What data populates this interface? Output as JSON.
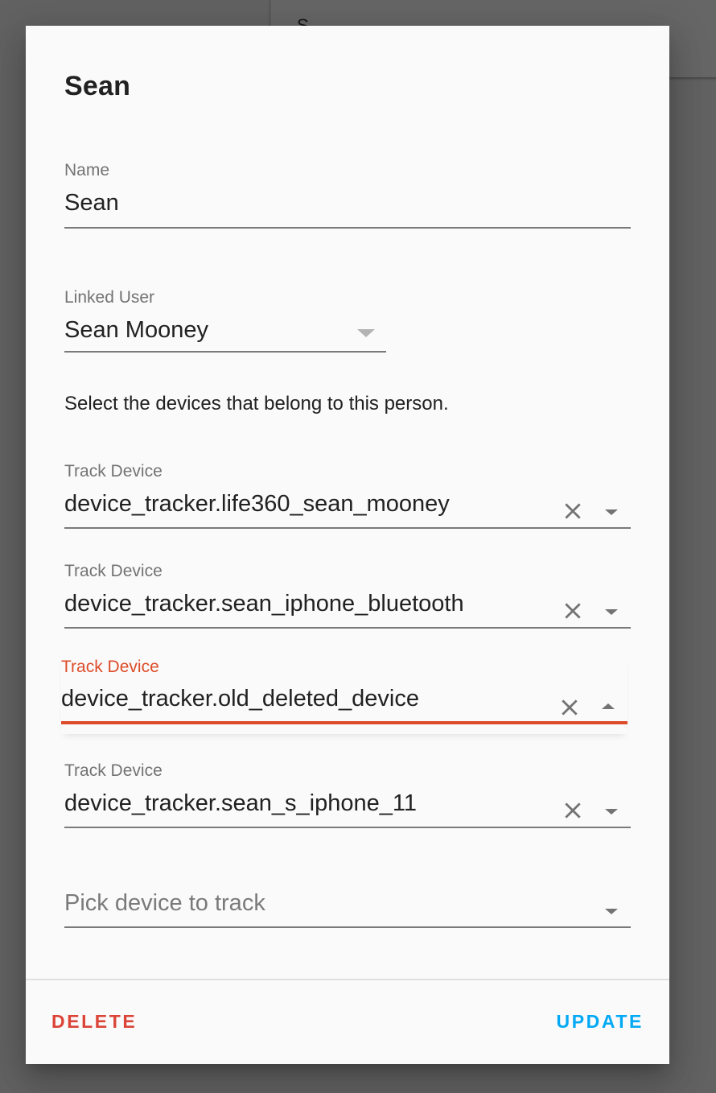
{
  "background": {
    "card_text": "S"
  },
  "dialog": {
    "title": "Sean",
    "name_field": {
      "label": "Name",
      "value": "Sean"
    },
    "linked_user": {
      "label": "Linked User",
      "value": "Sean Mooney"
    },
    "description": "Select the devices that belong to this person.",
    "track_devices": [
      {
        "label": "Track Device",
        "value": "device_tracker.life360_sean_mooney",
        "focused": false
      },
      {
        "label": "Track Device",
        "value": "device_tracker.sean_iphone_bluetooth",
        "focused": false
      },
      {
        "label": "Track Device",
        "value": "device_tracker.old_deleted_device",
        "focused": true
      },
      {
        "label": "Track Device",
        "value": "device_tracker.sean_s_iphone_11",
        "focused": false
      }
    ],
    "pick_device": {
      "placeholder": "Pick device to track"
    },
    "buttons": {
      "delete": "DELETE",
      "update": "UPDATE"
    }
  },
  "colors": {
    "accent_focus": "#dc4c28",
    "delete": "#db4437",
    "update": "#03a9f4"
  }
}
